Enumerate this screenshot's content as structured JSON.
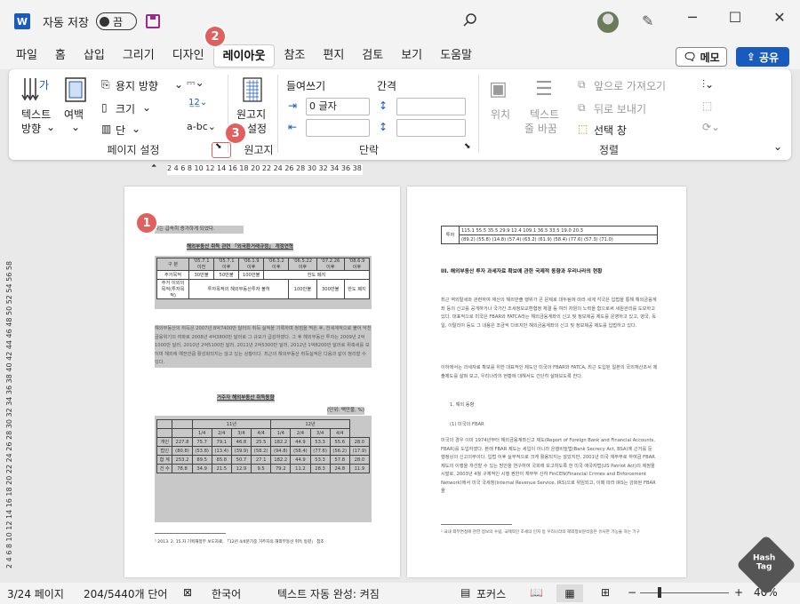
{
  "titlebar": {
    "autosave_label": "자동 저장",
    "toggle_label": "끔",
    "minimize": "─",
    "maximize": "☐",
    "close": "✕"
  },
  "menu": {
    "tabs": [
      "파일",
      "홈",
      "삽입",
      "그리기",
      "디자인",
      "레이아웃",
      "참조",
      "편지",
      "검토",
      "보기",
      "도움말"
    ],
    "active": "레이아웃",
    "memo_label": "메모",
    "share_label": "공유"
  },
  "ribbon": {
    "text_direction": "텍스트\n방향",
    "text_direction_1": "텍스트",
    "text_direction_2": "방향",
    "margins": "여백",
    "orientation": "용지 방향",
    "size": "크기",
    "columns": "단",
    "page_setup_group": "페이지 설정",
    "manuscript_1": "원고지",
    "manuscript_2": "설정",
    "manuscript_group": "원고지",
    "indent_label": "들여쓰기",
    "spacing_label": "간격",
    "indent_left_value": "0 글자",
    "indent_right_value": "",
    "spacing_before_value": "",
    "spacing_after_value": "",
    "paragraph_group": "단락",
    "position": "위치",
    "wrap_text_1": "텍스트",
    "wrap_text_2": "줄 바꿈",
    "bring_forward": "앞으로 가져오기",
    "send_backward": "뒤로 보내기",
    "selection_pane": "선택 창",
    "arrange_group": "정렬"
  },
  "badges": [
    "1",
    "2",
    "3"
  ],
  "ruler": {
    "ticks": "2  4  6  8 10 12 14 16 18 20 22 24 26 28 30 32 34 36 38 40 42 44",
    "vticks": "2  4  6  8 10 12 14 16 18 20 22 24 26 28 30 32 34 36 38 40 42 44 46 48 50 52 54 56 58"
  },
  "page1": {
    "line1": "자는 급속히 증가하게 되었다.",
    "heading1": "해외부동산 취득 관련 「외국환거래규정」 개정연혁",
    "table1_header": [
      "구 분",
      "'05.7.1 이전",
      "'05.7.1 이후",
      "'06.1.9 이후",
      "'06.3.2 이후",
      "'06.5.22 이후",
      "'07.2.26 이후",
      "'08.6.9 이후"
    ],
    "row_invest": "주거목적",
    "row_invest_vals": [
      "30만불",
      "50만불",
      "100만불",
      "",
      "한도 폐지"
    ],
    "row_other": "주거 이외의 목적(투자목적)",
    "row_other_vals": [
      "투자목적의 해외부동산투자 불허",
      "100만불",
      "300만불",
      "한도 폐지"
    ],
    "para1": "해외부동산의 취득은 2007년 8억7400만 달러의 취득 실적을 기록하며 정점을 찍은 후, 전세계적으로 불어 닥친 금융위기의 여파로 2008년 4억3800만 달러로 그 규모가 급감하였다. 그 후 해외부동산 투자는 2009년 2억1000만 달러, 2010년 2억5100만 달러, 2011년 2억5300만 달러, 2012년 1억8200만 달러로 위축세를 보이며 해외에 예전만큼 활성화되지는 않고 있는 상황이다. 최근의 해외부동산 취득실적은 다음과 같이 정리할 수 있다.",
    "heading2": "거주자 해외부동산 취득동향",
    "unit": "(단위: 백만불, %)",
    "table2_years": [
      "11년",
      "12년"
    ],
    "table2_quarters": [
      "1/4",
      "2/4",
      "3/4",
      "4/4",
      "1/4",
      "2/4",
      "3/4",
      "4/4"
    ],
    "table2_rows": [
      {
        "label": "개인",
        "vals": [
          "227.8",
          "75.7",
          "79.1",
          "46.8",
          "25.5",
          "182.2",
          "44.9",
          "53.3",
          "55.6",
          "28.0"
        ]
      },
      {
        "label": "법인",
        "vals": [
          "(80.8)",
          "(53.8)",
          "(13.4)",
          "(39.9)",
          "(58.2)",
          "(94.8)",
          "(58.4)",
          "(77.6)",
          "(56.2)",
          "(17.9)"
        ]
      },
      {
        "label": "합 계",
        "vals": [
          "253.2",
          "89.5",
          "85.8",
          "50.7",
          "27.1",
          "182.2",
          "44.9",
          "53.3",
          "57.8",
          "28.0"
        ]
      },
      {
        "label": "건 수",
        "vals": [
          "78.8",
          "34.9",
          "21.5",
          "12.9",
          "9.5",
          "79.2",
          "11.2",
          "28.3",
          "24.8",
          "11.9"
        ]
      }
    ],
    "footnote": "¹ 2013. 2. 15.자 기획재정부 보도자료, 「12년 4/4분기중 거주자의 해외부동산 취득 동향」 참조"
  },
  "page2": {
    "top_row": "투자",
    "top_vals": "115.1  55.5  35.5  29.9  12.4  109.1  36.5  33.5  19.0  20.3",
    "top_vals2": "(89.2) (55.8) (14.8) (57.4) (63.2) (61.9) (58.4) (77.6) (57.3) (71.0)",
    "heading": "III. 해외부동산 투자 과세자료 확보에 관한 국제적 동향과 우리나라의 현황",
    "para1": "최근 역외탈세와 관련하여 재산의 해외반출 행위가 큰 문제로 대두됨에 따라 세계 각국은 입법을 통해 해외금융계좌 등의 신고를 공개하거나 국가간 조세정보교환협정 체결 등 여러 차원의 노력을 함으로써 세원관리를 도모하고 있다. 대표적으로 미국은 FBAR와 FATCA라는 해외금융계좌의 신고 및 정보제공 제도를 운영하고 있고, 영국, 독일, 이탈리아 등도 그 내용은 조금씩 다르지만 해외금융계좌의 신고 및 정보제공 제도를 입법하고 있다.",
    "para2": "이하에서는 과세자료 확보를 위한 대표적인 제도인 미국의 FBAR와 FATCA, 최근 도입된 일본의 국외재산조서 제출제도를 살펴 보고, 우리나라의 현황에 대해서도 간단히 살펴보도록 한다.",
    "item1": "1. 해외 동향",
    "item2": "(1) 미국의 FBAR",
    "para3": "미국의 경우 이미 1974년부터 해외금융계좌신고 제도(Report of Foreign Bank and Financial Accounts, FBAR)를 도입하였다. 본래 FBAR 제도는 세입이 아니라 은행비밀법(Bank Secrecy Act, BSA)에 근거를 둔 행정상의 신고의무이다. 입법 이후 실무적으로 크게 활용되지는 않았지만, 2001년 미국 재무부로 하여금 FBAR 제도의 이행을 개선할 수 있는 방안을 연구하여 국회에 보고하도록 한 미국 애국자법(US Patriot Act)의 제정을 시발로, 2003년 4월 구체적인 시행 권한이 재무부 산하 FinCEN(Financial Crimes and Enforcement Network)에서 미국 국세청(Internal Revenue Service, IRS)으로 위임되고, 이때 따라 IRS는 강화된 FBAR을",
    "footnote": "¹ 국내 외부면접에 관한 정보의 수립, 국제적인 조세의 인지 등 우리나라의 해외정보분석중은 유사한 기능을 하는 기구"
  },
  "status": {
    "page": "3/24 페이지",
    "words": "204/5440개 단어",
    "language": "한국어",
    "autocomplete": "텍스트 자동 완성: 켜짐",
    "focus": "포커스",
    "zoom": "40%",
    "zoom_minus": "−",
    "zoom_plus": "+"
  },
  "watermark": {
    "line1": "Hash",
    "line2": "Tag"
  }
}
